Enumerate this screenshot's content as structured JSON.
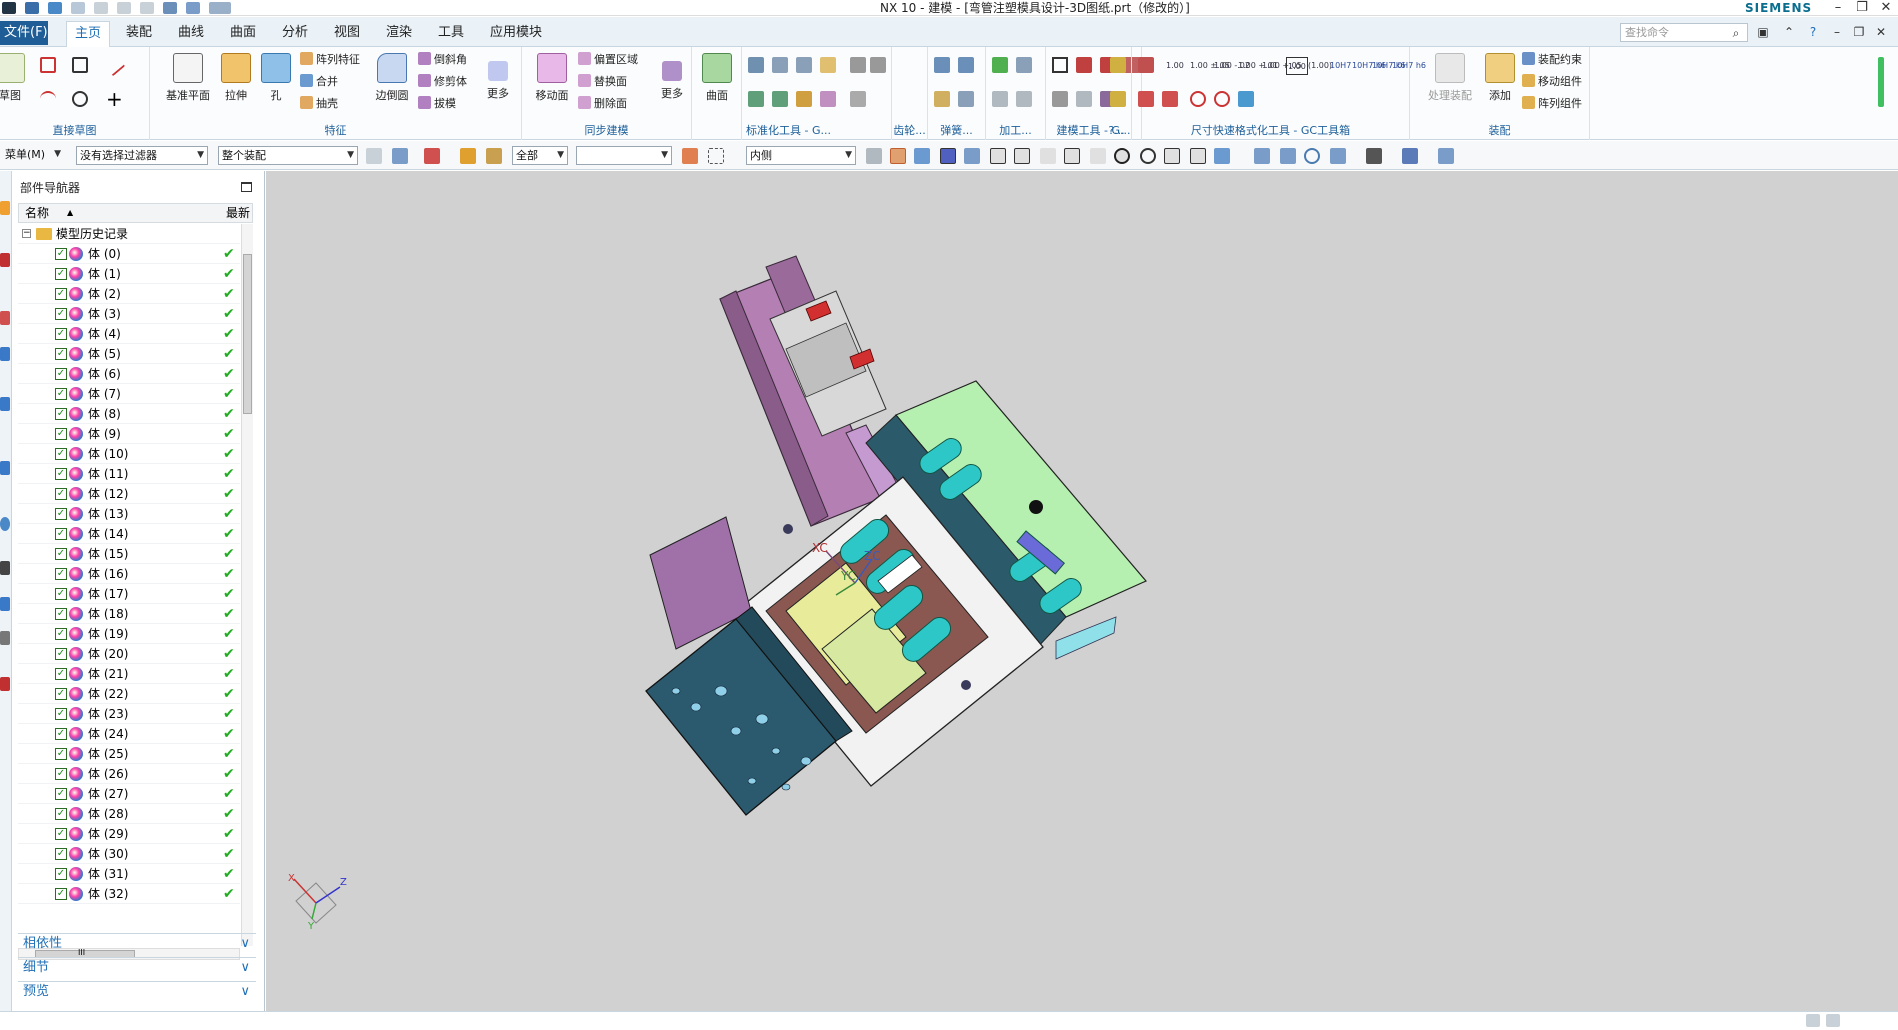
{
  "window": {
    "title": "NX 10 - 建模 - [弯管注塑模具设计-3D图纸.prt（修改的）]",
    "brand": "SIEMENS",
    "minimize": "–",
    "restore": "❐",
    "close": "✕"
  },
  "menubar": {
    "file": "文件(F)",
    "tabs": [
      "主页",
      "装配",
      "曲线",
      "曲面",
      "分析",
      "视图",
      "渲染",
      "工具",
      "应用模块"
    ],
    "active_tab": "主页",
    "search_placeholder": "查找命令"
  },
  "ribbon": {
    "groups": {
      "direct_sketch": "直接草图",
      "feature": "特征",
      "sync_modeling": "同步建模",
      "std_tools": "标准化工具 - G...",
      "gear": "齿轮...",
      "spring": "弹簧...",
      "machining": "加工...",
      "modeling_tools": "建模工具 - G...",
      "more": "?...",
      "dim_tools": "尺寸快速格式化工具 - GC工具箱",
      "assembly": "装配"
    },
    "buttons": {
      "sketch": "草图",
      "datum_plane": "基准平面",
      "extrude": "拉伸",
      "hole": "孔",
      "pattern_feature": "阵列特征",
      "unite": "合并",
      "shell": "抽壳",
      "edge_blend": "边倒圆",
      "chamfer": "倒斜角",
      "trim_body": "修剪体",
      "draft": "拔模",
      "more1": "更多",
      "move_face": "移动面",
      "offset_region": "偏置区域",
      "replace_face": "替换面",
      "delete_face": "删除面",
      "more2": "更多",
      "surface": "曲面",
      "process_assembly": "处理装配",
      "add": "添加",
      "assembly_constraint": "装配约束",
      "move_component": "移动组件",
      "pattern_component": "阵列组件"
    },
    "dim_labels": [
      "1.00",
      "1.00\n±.05",
      "1.00\n-.02",
      "1.00\n+.01",
      "1.00\n+.05",
      "1.00",
      "(1.00)",
      "10H7",
      "10H7\nh6",
      "10H7\nk6",
      "10H7\nh6"
    ]
  },
  "selection_bar": {
    "menu": "菜单(M)",
    "filter": "没有选择过滤器",
    "scope": "整个装配",
    "type": "全部",
    "blank": "",
    "mode": "内侧"
  },
  "navigator": {
    "title": "部件导航器",
    "col_name": "名称",
    "col_latest": "最新",
    "root": "模型历史记录",
    "items": [
      "体 (0)",
      "体 (1)",
      "体 (2)",
      "体 (3)",
      "体 (4)",
      "体 (5)",
      "体 (6)",
      "体 (7)",
      "体 (8)",
      "体 (9)",
      "体 (10)",
      "体 (11)",
      "体 (12)",
      "体 (13)",
      "体 (14)",
      "体 (15)",
      "体 (16)",
      "体 (17)",
      "体 (18)",
      "体 (19)",
      "体 (20)",
      "体 (21)",
      "体 (22)",
      "体 (23)",
      "体 (24)",
      "体 (25)",
      "体 (26)",
      "体 (27)",
      "体 (28)",
      "体 (29)",
      "体 (30)",
      "体 (31)",
      "体 (32)"
    ],
    "panels": [
      "相依性",
      "细节",
      "预览"
    ],
    "scroll_dots": "III"
  },
  "viewport": {
    "csys": {
      "xc": "XC",
      "yc": "YC",
      "zc": "ZC"
    },
    "triad": {
      "x": "X",
      "y": "Y",
      "z": "Z"
    }
  },
  "colors": {
    "file_tab": "#1e5d96",
    "accent": "#1f6fb5",
    "viewport_bg": "#d1d1d1",
    "check_ok": "#1fae1f"
  }
}
